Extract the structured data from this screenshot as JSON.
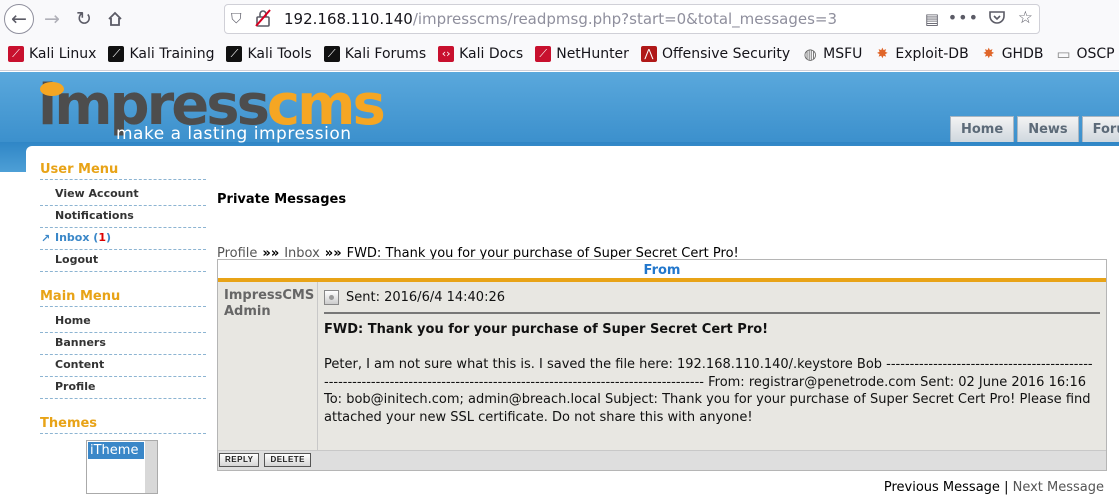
{
  "browser": {
    "url_host": "192.168.110.140",
    "url_path": "/impresscms/readpmsg.php?start=0&total_messages=3",
    "bookmarks": [
      {
        "label": "Kali Linux",
        "icon": "kali-dragon-icon",
        "color": "#c8102e"
      },
      {
        "label": "Kali Training",
        "icon": "kali-dragon-icon",
        "color": "#111111"
      },
      {
        "label": "Kali Tools",
        "icon": "kali-dragon-icon",
        "color": "#111111"
      },
      {
        "label": "Kali Forums",
        "icon": "kali-dragon-icon",
        "color": "#111111"
      },
      {
        "label": "Kali Docs",
        "icon": "docs-icon",
        "color": "#c8102e"
      },
      {
        "label": "NetHunter",
        "icon": "kali-dragon-icon",
        "color": "#c8102e"
      },
      {
        "label": "Offensive Security",
        "icon": "offsec-icon",
        "color": "#b01818"
      },
      {
        "label": "MSFU",
        "icon": "globe-icon",
        "color": "#666666"
      },
      {
        "label": "Exploit-DB",
        "icon": "exploitdb-icon",
        "color": "#e0662a"
      },
      {
        "label": "GHDB",
        "icon": "exploitdb-icon",
        "color": "#e0662a"
      },
      {
        "label": "OSCP",
        "icon": "folder-icon",
        "color": "#888888"
      }
    ]
  },
  "site": {
    "logo_main_a": "impress",
    "logo_main_b": "cms",
    "logo_tagline": "make a lasting impression",
    "nav_tabs": [
      "Home",
      "News",
      "Forum"
    ]
  },
  "sidebar": {
    "user_menu_title": "User Menu",
    "user_menu": {
      "view_account": "View Account",
      "notifications": "Notifications",
      "inbox": "Inbox",
      "inbox_count": "1",
      "logout": "Logout"
    },
    "main_menu_title": "Main Menu",
    "main_menu": [
      "Home",
      "Banners",
      "Content",
      "Profile"
    ],
    "themes_title": "Themes",
    "theme_selected": "iTheme"
  },
  "main": {
    "title": "Private Messages",
    "breadcrumb": {
      "profile": "Profile",
      "sep": "»»",
      "inbox": "Inbox",
      "current": "FWD: Thank you for your purchase of Super Secret Cert Pro!"
    },
    "table_header": "From",
    "sender": "ImpressCMS Admin",
    "sent": "Sent: 2016/6/4 14:40:26",
    "subject": "FWD: Thank you for your purchase of Super Secret Cert Pro!",
    "body": "Peter, I am not sure what this is. I saved the file here: 192.168.110.140/.keystore Bob ----------------------------------------------------------------------------------------------------------------------------- From: registrar@penetrode.com Sent: 02 June 2016 16:16 To: bob@initech.com; admin@breach.local Subject: Thank you for your purchase of Super Secret Cert Pro! Please find attached your new SSL certificate. Do not share this with anyone!",
    "reply_label": "REPLY",
    "delete_label": "DELETE",
    "prev_label": "Previous Message",
    "pager_sep": "|",
    "next_label": "Next Message"
  }
}
